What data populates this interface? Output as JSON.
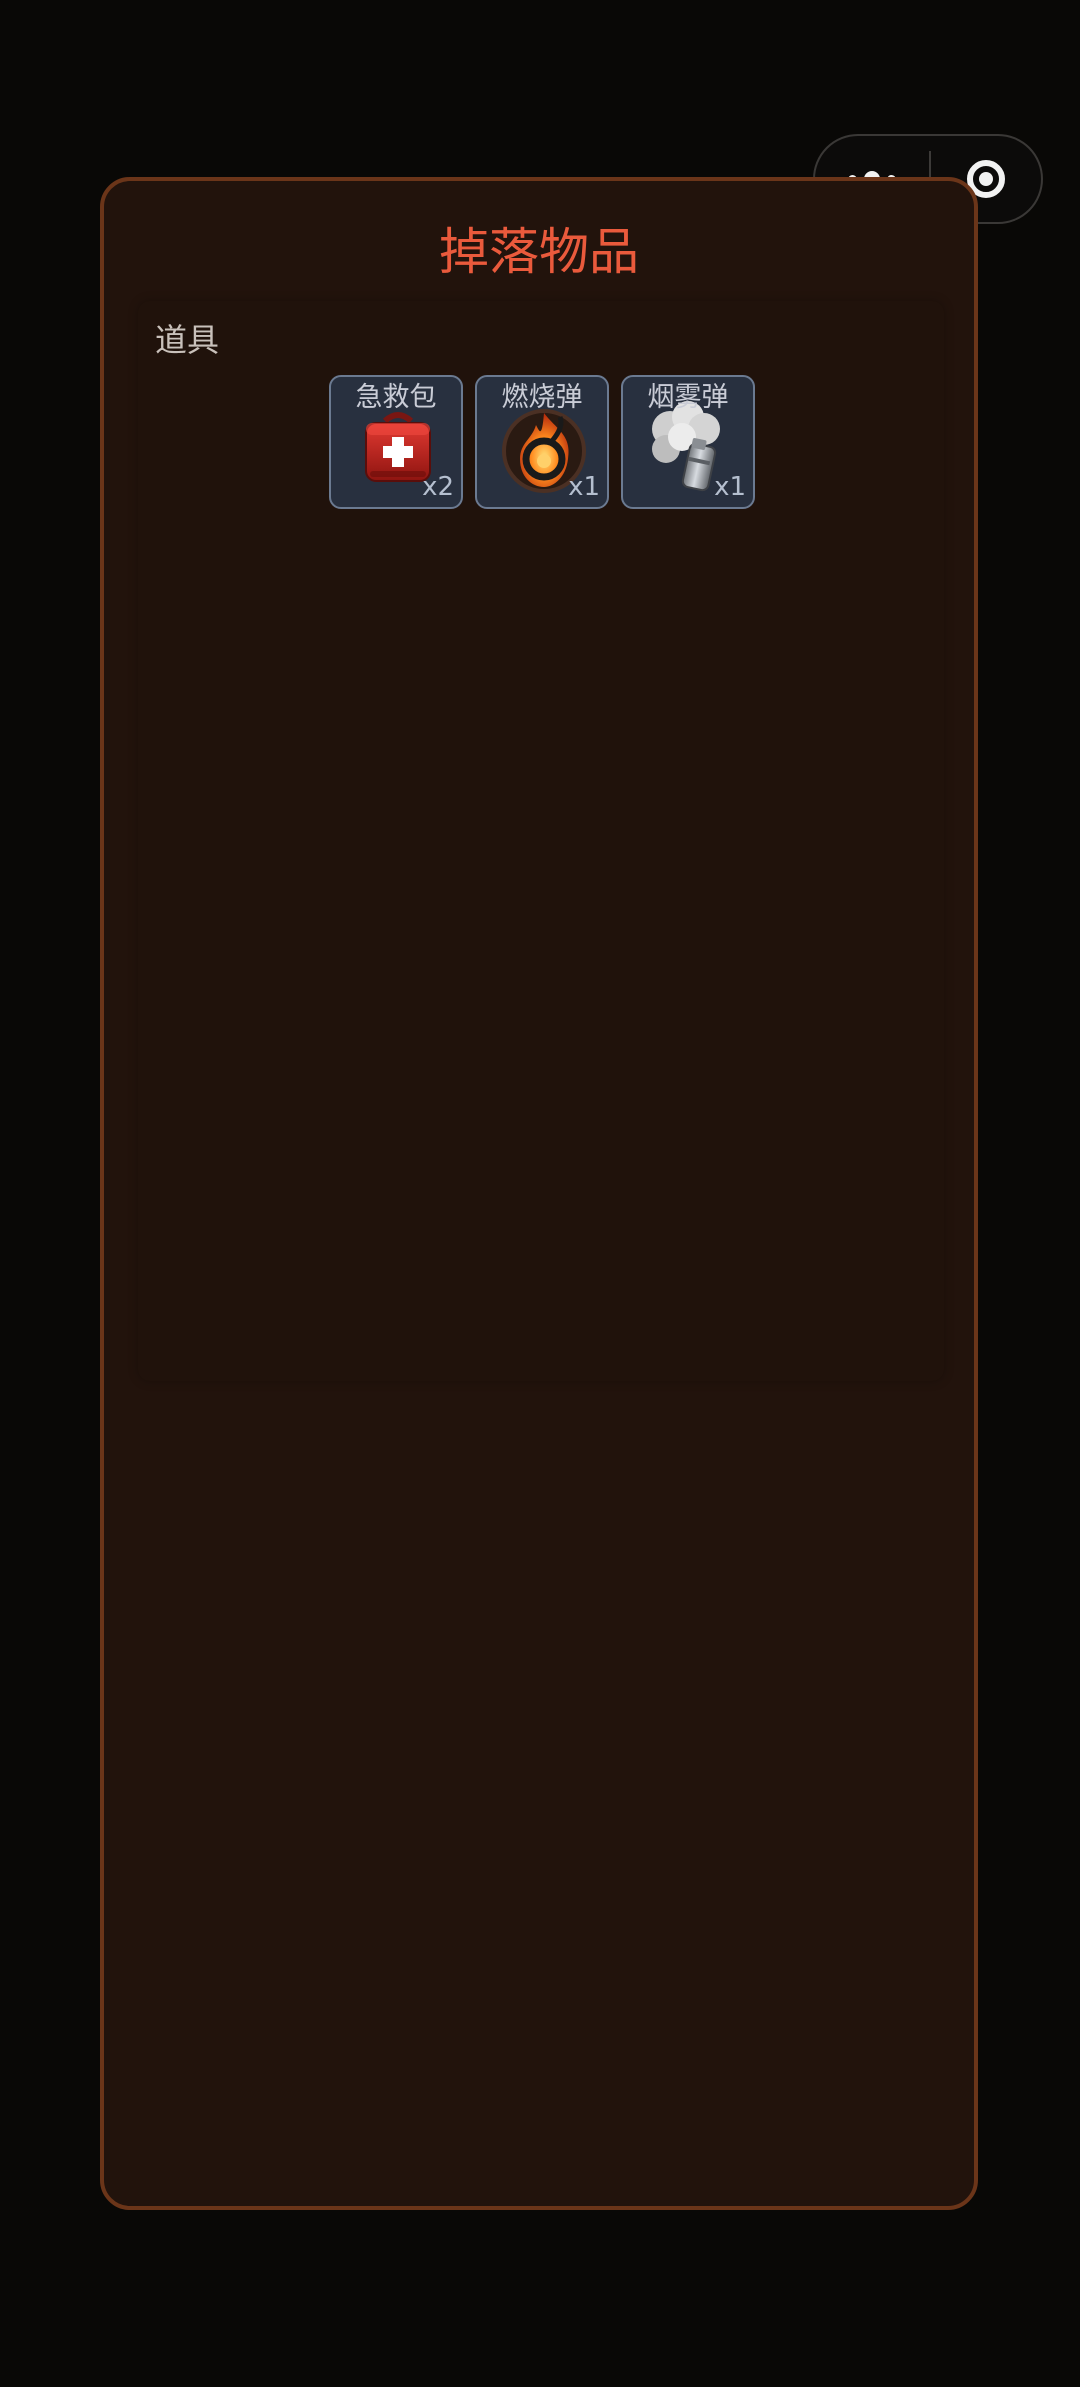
{
  "dialog": {
    "title": "掉落物品"
  },
  "section": {
    "title": "道具",
    "items": [
      {
        "name": "急救包",
        "count": "x2",
        "icon": "first-aid-kit-icon"
      },
      {
        "name": "燃烧弹",
        "count": "x1",
        "icon": "incendiary-grenade-icon"
      },
      {
        "name": "烟雾弹",
        "count": "x1",
        "icon": "smoke-grenade-icon"
      }
    ]
  },
  "colors": {
    "background": "#090806",
    "dialog_bg": "#22130c",
    "dialog_border": "#6b3519",
    "title": "#ea5a3c",
    "item_bg": "#28303f",
    "item_border": "#6b7a91"
  }
}
